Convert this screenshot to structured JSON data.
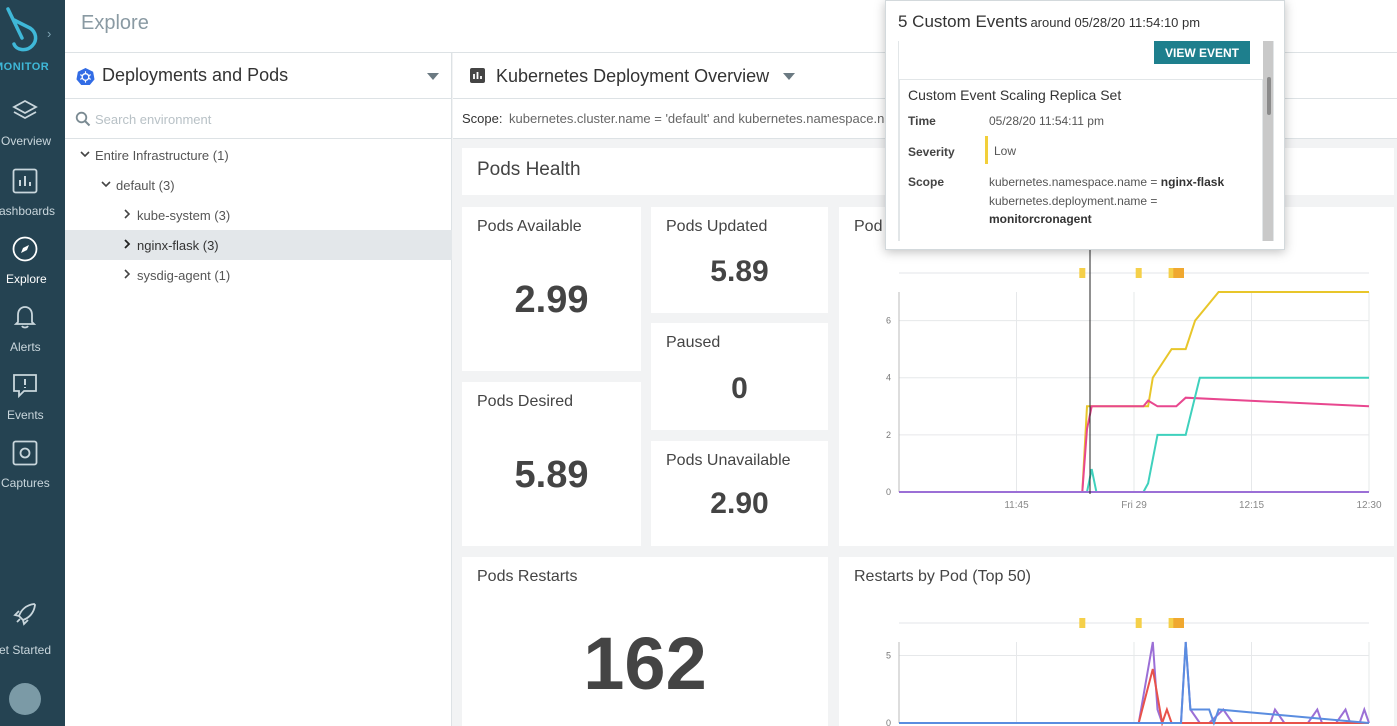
{
  "nav": {
    "brand": "MONITOR",
    "items": [
      {
        "label": "Overview",
        "icon": "overview-icon"
      },
      {
        "label": "ashboards",
        "icon": "dashboards-icon"
      },
      {
        "label": "Explore",
        "icon": "explore-icon"
      },
      {
        "label": "Alerts",
        "icon": "alerts-icon"
      },
      {
        "label": "Events",
        "icon": "events-icon"
      },
      {
        "label": "Captures",
        "icon": "captures-icon"
      },
      {
        "label": "et Started",
        "icon": "rocket-icon"
      }
    ],
    "active": "Explore"
  },
  "topbar": {
    "title": "Explore"
  },
  "environment": {
    "selector_label": "Deployments and Pods",
    "search_placeholder": "Search environment",
    "tree": [
      {
        "label": "Entire Infrastructure (1)",
        "level": 0,
        "expanded": true
      },
      {
        "label": "default (3)",
        "level": 1,
        "expanded": true
      },
      {
        "label": "kube-system (3)",
        "level": 2,
        "expanded": false
      },
      {
        "label": "nginx-flask (3)",
        "level": 2,
        "expanded": false,
        "selected": true
      },
      {
        "label": "sysdig-agent (1)",
        "level": 2,
        "expanded": false
      }
    ]
  },
  "dashboard": {
    "name": "Kubernetes Deployment Overview",
    "scope_label": "Scope:",
    "scope_value": "kubernetes.cluster.name = 'default' and kubernetes.namespace.name",
    "section_title": "Pods Health",
    "tiles": {
      "pods_available": {
        "title": "Pods Available",
        "value": "2.99"
      },
      "pods_desired": {
        "title": "Pods Desired",
        "value": "5.89"
      },
      "pods_updated": {
        "title": "Pods Updated",
        "value": "5.89"
      },
      "paused": {
        "title": "Paused",
        "value": "0"
      },
      "pods_unavailable": {
        "title": "Pods Unavailable",
        "value": "2.90"
      },
      "pods_restarts": {
        "title": "Pods Restarts",
        "value": "162"
      }
    },
    "pod_chart_title": "Pod",
    "restarts_chart_title": "Restarts by Pod (Top 50)"
  },
  "popup": {
    "title": "5 Custom Events",
    "subtitle": "around 05/28/20 11:54:10 pm",
    "button": "VIEW EVENT",
    "event": {
      "title": "Custom Event Scaling Replica Set",
      "time_label": "Time",
      "time_value": "05/28/20 11:54:11 pm",
      "severity_label": "Severity",
      "severity_value": "Low",
      "scope_label": "Scope",
      "scope_line1_key": "kubernetes.namespace.name = ",
      "scope_line1_val": "nginx-flask",
      "scope_line2_key": "kubernetes.deployment.name =",
      "scope_line2_val": "monitorcronagent"
    }
  },
  "chart_data": [
    {
      "type": "line",
      "title": "Pod",
      "x_ticks": [
        "11:45",
        "Fri 29",
        "12:15",
        "12:30"
      ],
      "ylim": [
        0,
        7
      ],
      "y_ticks": [
        0,
        2,
        4,
        6
      ],
      "grid": true,
      "series": [
        {
          "color": "#e8c62a",
          "x": [
            0,
            0.39,
            0.4,
            0.5,
            0.53,
            0.54,
            0.58,
            0.6,
            0.61,
            0.63,
            0.68,
            1.0
          ],
          "y": [
            0,
            0,
            3,
            3,
            3,
            4,
            5,
            5,
            5,
            6,
            7,
            7
          ]
        },
        {
          "color": "#e8478f",
          "x": [
            0,
            0.39,
            0.4,
            0.41,
            0.52,
            0.53,
            0.55,
            0.59,
            0.61,
            1.0
          ],
          "y": [
            0,
            0,
            2.2,
            3,
            3,
            3.2,
            3,
            3,
            3.3,
            3
          ]
        },
        {
          "color": "#3fd1bd",
          "x": [
            0,
            0.4,
            0.41,
            0.42,
            0.52,
            0.53,
            0.55,
            0.59,
            0.61,
            0.64,
            1.0
          ],
          "y": [
            0,
            0,
            0.8,
            0,
            0,
            0.3,
            2,
            2,
            2,
            4,
            4
          ]
        },
        {
          "color": "#9b6fd6",
          "x": [
            0,
            1.0
          ],
          "y": [
            0,
            0
          ]
        }
      ],
      "event_markers": [
        0.39,
        0.51,
        0.58,
        0.59,
        0.6
      ]
    },
    {
      "type": "line",
      "title": "Restarts by Pod (Top 50)",
      "x_ticks": [],
      "ylim": [
        0,
        6
      ],
      "y_ticks": [
        0,
        5
      ],
      "grid": true,
      "series": [
        {
          "color": "#9b6fd6",
          "x": [
            0,
            0.51,
            0.54,
            0.55,
            0.56,
            0.6,
            0.61,
            0.62,
            0.64,
            0.66,
            0.69,
            0.71,
            0.79,
            0.8,
            0.82,
            0.87,
            0.89,
            0.9,
            0.93,
            0.95,
            0.96,
            0.98,
            0.99,
            1.0
          ],
          "y": [
            0,
            0,
            6,
            1,
            0,
            0,
            6,
            1,
            0,
            0,
            1,
            0,
            0,
            1,
            0,
            0,
            1,
            0,
            0,
            1,
            0,
            0,
            1,
            0
          ]
        },
        {
          "color": "#e8524a",
          "x": [
            0,
            0.51,
            0.54,
            0.56,
            0.57,
            0.58,
            1.0
          ],
          "y": [
            0,
            0,
            4,
            0,
            1,
            0,
            0
          ]
        },
        {
          "color": "#5a8de0",
          "x": [
            0,
            0.6,
            0.61,
            0.62,
            0.66,
            0.67,
            0.68,
            1.0
          ],
          "y": [
            0,
            0,
            6,
            1,
            1,
            0,
            1,
            0
          ]
        }
      ],
      "event_markers": [
        0.39,
        0.51,
        0.58,
        0.59,
        0.6
      ]
    }
  ]
}
